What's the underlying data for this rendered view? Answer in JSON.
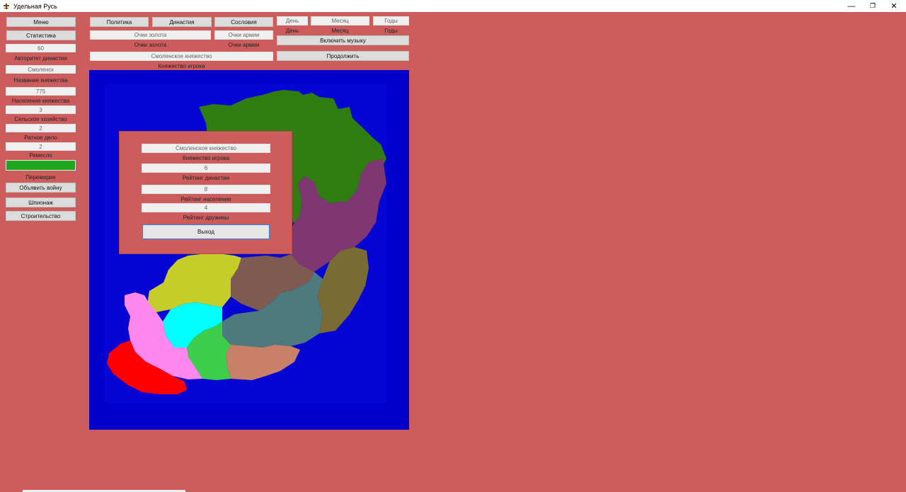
{
  "window": {
    "title": "Удельная Русь",
    "minimize": "—",
    "maximize": "❐",
    "close": "✕"
  },
  "left": {
    "menu": "Меню",
    "stats": "Статистика",
    "authority_value": "60",
    "authority_label": "Авторитет династии",
    "name_value": "Смоленск",
    "name_label": "Название княжества",
    "population_value": "775",
    "population_label": "Население княжества",
    "agriculture_value": "3",
    "agriculture_label": "Сельское хозяйство",
    "military_value": "2",
    "military_label": "Ратное дело",
    "craft_value": "2",
    "craft_label": "Ремесло",
    "truce_color": "#1EA71E",
    "truce_label": "Перемирие",
    "declare_war": "Объявить войну",
    "espionage": "Шпионаж",
    "construction": "Строительство"
  },
  "top": {
    "politics": "Политика",
    "dynasty": "Династия",
    "estates": "Сословия",
    "gold_field": "Очки золота",
    "gold_label": "Очки золота",
    "army_field": "Очки армии",
    "army_label": "Очки армии",
    "principality_field": "Смоленское княжество",
    "principality_label": "Княжество игрока",
    "day_field": "День",
    "day_label": "День",
    "month_field": "Месяц",
    "month_label": "Месяц",
    "years_field": "Годы",
    "years_label": "Годы",
    "music": "Включить музыку",
    "continue": "Продолжить"
  },
  "dialog": {
    "principality": "Смоленское княжество",
    "principality_label": "Княжество игрока",
    "dynasty_rating": "6",
    "dynasty_label": "Рейтинг династии",
    "population_rating": "8",
    "population_label": "Рейтинг население",
    "squad_rating": "4",
    "squad_label": "Рейтинг дружины",
    "exit": "Выход"
  },
  "map_colors": {
    "sea": "#0000CD",
    "inner_sea": "#0505D5",
    "north": "#2E7D0E",
    "purple": "#7E3770",
    "olive": "#7A6A34",
    "brown": "#7F5A50",
    "teal": "#4C7A7D",
    "salmon": "#C98066",
    "yellow": "#C6CC2A",
    "cyan": "#00FFFF",
    "green": "#3ECF4A",
    "pink": "#FF88EE",
    "red": "#FF0000"
  }
}
